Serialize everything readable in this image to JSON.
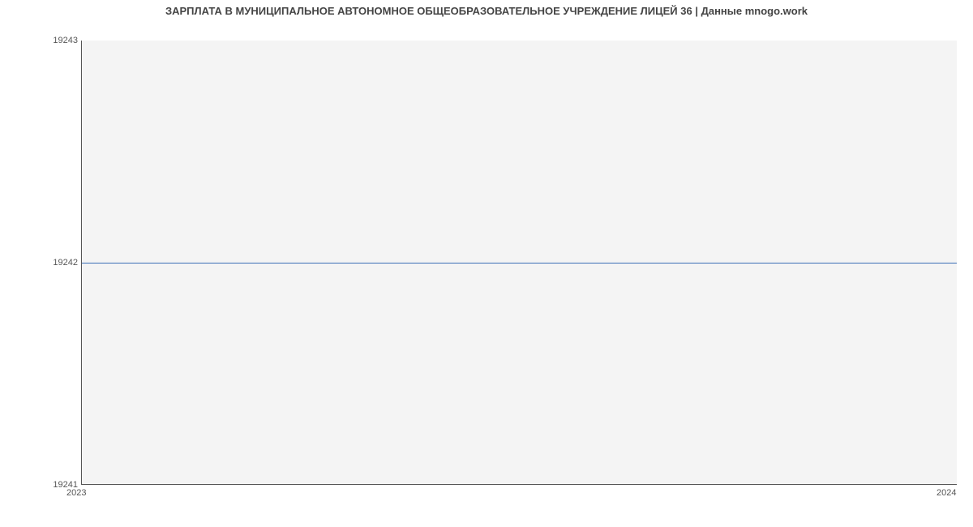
{
  "chart_data": {
    "type": "line",
    "title": "ЗАРПЛАТА В МУНИЦИПАЛЬНОЕ АВТОНОМНОЕ ОБЩЕОБРАЗОВАТЕЛЬНОЕ УЧРЕЖДЕНИЕ ЛИЦЕЙ 36 | Данные mnogo.work",
    "x": [
      "2023",
      "2024"
    ],
    "series": [
      {
        "name": "salary",
        "values": [
          19242,
          19242
        ],
        "color": "#3b6fb6"
      }
    ],
    "xlabel": "",
    "ylabel": "",
    "y_ticks": [
      "19241",
      "19242",
      "19243"
    ],
    "x_ticks": [
      "2023",
      "2024"
    ],
    "ylim": [
      19241,
      19243
    ],
    "grid": false,
    "background": "#f4f4f4"
  }
}
